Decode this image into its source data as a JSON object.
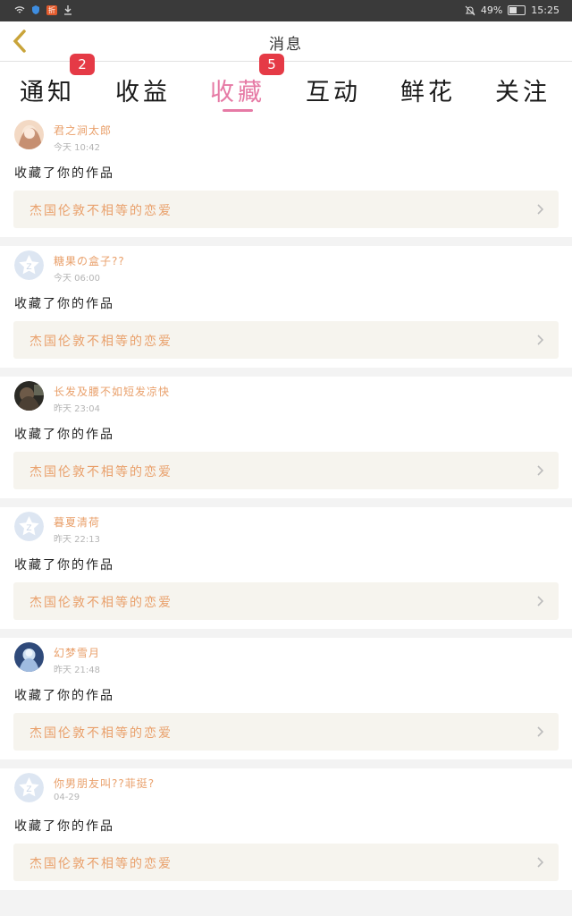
{
  "status_bar": {
    "battery": "49%",
    "time": "15:25",
    "notif_label": "折"
  },
  "header": {
    "title": "消息"
  },
  "tabs": [
    {
      "label": "通知",
      "badge": "2",
      "active": false
    },
    {
      "label": "收益",
      "badge": null,
      "active": false
    },
    {
      "label": "收藏",
      "badge": "5",
      "active": true
    },
    {
      "label": "互动",
      "badge": null,
      "active": false
    },
    {
      "label": "鲜花",
      "badge": null,
      "active": false
    },
    {
      "label": "关注",
      "badge": null,
      "active": false
    }
  ],
  "items": [
    {
      "username": "君之涧太郎",
      "time": "今天 10:42",
      "action": "收藏了你的作品",
      "work_title": "杰国伦敦不相等的恋爱",
      "avatar": "photo-avatar-anime"
    },
    {
      "username": "糖果の盒子??",
      "time": "今天 06:00",
      "action": "收藏了你的作品",
      "work_title": "杰国伦敦不相等的恋爱",
      "avatar": "default-avatar"
    },
    {
      "username": "长发及腰不如短发凉快",
      "time": "昨天 23:04",
      "action": "收藏了你的作品",
      "work_title": "杰国伦敦不相等的恋爱",
      "avatar": "photo-avatar-dark"
    },
    {
      "username": "暮夏清荷",
      "time": "昨天 22:13",
      "action": "收藏了你的作品",
      "work_title": "杰国伦敦不相等的恋爱",
      "avatar": "default-avatar"
    },
    {
      "username": "幻梦雪月",
      "time": "昨天 21:48",
      "action": "收藏了你的作品",
      "work_title": "杰国伦敦不相等的恋爱",
      "avatar": "photo-avatar-blue"
    },
    {
      "username": "你男朋友叫??菲挺?",
      "time": "04-29",
      "action": "收藏了你的作品",
      "work_title": "杰国伦敦不相等的恋爱",
      "avatar": "default-avatar"
    }
  ],
  "colors": {
    "accent": "#e67aa5",
    "badge": "#e53a46",
    "username": "#e9a06b",
    "link_bg": "#f6f4ee"
  }
}
